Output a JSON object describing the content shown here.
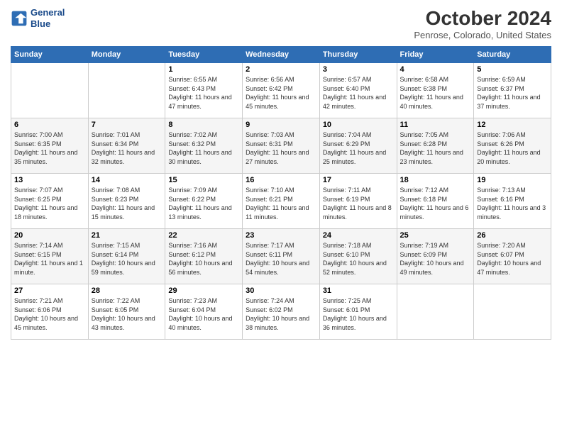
{
  "header": {
    "logo_line1": "General",
    "logo_line2": "Blue",
    "month_title": "October 2024",
    "subtitle": "Penrose, Colorado, United States"
  },
  "weekdays": [
    "Sunday",
    "Monday",
    "Tuesday",
    "Wednesday",
    "Thursday",
    "Friday",
    "Saturday"
  ],
  "weeks": [
    [
      {
        "day": "",
        "info": ""
      },
      {
        "day": "",
        "info": ""
      },
      {
        "day": "1",
        "info": "Sunrise: 6:55 AM\nSunset: 6:43 PM\nDaylight: 11 hours and 47 minutes."
      },
      {
        "day": "2",
        "info": "Sunrise: 6:56 AM\nSunset: 6:42 PM\nDaylight: 11 hours and 45 minutes."
      },
      {
        "day": "3",
        "info": "Sunrise: 6:57 AM\nSunset: 6:40 PM\nDaylight: 11 hours and 42 minutes."
      },
      {
        "day": "4",
        "info": "Sunrise: 6:58 AM\nSunset: 6:38 PM\nDaylight: 11 hours and 40 minutes."
      },
      {
        "day": "5",
        "info": "Sunrise: 6:59 AM\nSunset: 6:37 PM\nDaylight: 11 hours and 37 minutes."
      }
    ],
    [
      {
        "day": "6",
        "info": "Sunrise: 7:00 AM\nSunset: 6:35 PM\nDaylight: 11 hours and 35 minutes."
      },
      {
        "day": "7",
        "info": "Sunrise: 7:01 AM\nSunset: 6:34 PM\nDaylight: 11 hours and 32 minutes."
      },
      {
        "day": "8",
        "info": "Sunrise: 7:02 AM\nSunset: 6:32 PM\nDaylight: 11 hours and 30 minutes."
      },
      {
        "day": "9",
        "info": "Sunrise: 7:03 AM\nSunset: 6:31 PM\nDaylight: 11 hours and 27 minutes."
      },
      {
        "day": "10",
        "info": "Sunrise: 7:04 AM\nSunset: 6:29 PM\nDaylight: 11 hours and 25 minutes."
      },
      {
        "day": "11",
        "info": "Sunrise: 7:05 AM\nSunset: 6:28 PM\nDaylight: 11 hours and 23 minutes."
      },
      {
        "day": "12",
        "info": "Sunrise: 7:06 AM\nSunset: 6:26 PM\nDaylight: 11 hours and 20 minutes."
      }
    ],
    [
      {
        "day": "13",
        "info": "Sunrise: 7:07 AM\nSunset: 6:25 PM\nDaylight: 11 hours and 18 minutes."
      },
      {
        "day": "14",
        "info": "Sunrise: 7:08 AM\nSunset: 6:23 PM\nDaylight: 11 hours and 15 minutes."
      },
      {
        "day": "15",
        "info": "Sunrise: 7:09 AM\nSunset: 6:22 PM\nDaylight: 11 hours and 13 minutes."
      },
      {
        "day": "16",
        "info": "Sunrise: 7:10 AM\nSunset: 6:21 PM\nDaylight: 11 hours and 11 minutes."
      },
      {
        "day": "17",
        "info": "Sunrise: 7:11 AM\nSunset: 6:19 PM\nDaylight: 11 hours and 8 minutes."
      },
      {
        "day": "18",
        "info": "Sunrise: 7:12 AM\nSunset: 6:18 PM\nDaylight: 11 hours and 6 minutes."
      },
      {
        "day": "19",
        "info": "Sunrise: 7:13 AM\nSunset: 6:16 PM\nDaylight: 11 hours and 3 minutes."
      }
    ],
    [
      {
        "day": "20",
        "info": "Sunrise: 7:14 AM\nSunset: 6:15 PM\nDaylight: 11 hours and 1 minute."
      },
      {
        "day": "21",
        "info": "Sunrise: 7:15 AM\nSunset: 6:14 PM\nDaylight: 10 hours and 59 minutes."
      },
      {
        "day": "22",
        "info": "Sunrise: 7:16 AM\nSunset: 6:12 PM\nDaylight: 10 hours and 56 minutes."
      },
      {
        "day": "23",
        "info": "Sunrise: 7:17 AM\nSunset: 6:11 PM\nDaylight: 10 hours and 54 minutes."
      },
      {
        "day": "24",
        "info": "Sunrise: 7:18 AM\nSunset: 6:10 PM\nDaylight: 10 hours and 52 minutes."
      },
      {
        "day": "25",
        "info": "Sunrise: 7:19 AM\nSunset: 6:09 PM\nDaylight: 10 hours and 49 minutes."
      },
      {
        "day": "26",
        "info": "Sunrise: 7:20 AM\nSunset: 6:07 PM\nDaylight: 10 hours and 47 minutes."
      }
    ],
    [
      {
        "day": "27",
        "info": "Sunrise: 7:21 AM\nSunset: 6:06 PM\nDaylight: 10 hours and 45 minutes."
      },
      {
        "day": "28",
        "info": "Sunrise: 7:22 AM\nSunset: 6:05 PM\nDaylight: 10 hours and 43 minutes."
      },
      {
        "day": "29",
        "info": "Sunrise: 7:23 AM\nSunset: 6:04 PM\nDaylight: 10 hours and 40 minutes."
      },
      {
        "day": "30",
        "info": "Sunrise: 7:24 AM\nSunset: 6:02 PM\nDaylight: 10 hours and 38 minutes."
      },
      {
        "day": "31",
        "info": "Sunrise: 7:25 AM\nSunset: 6:01 PM\nDaylight: 10 hours and 36 minutes."
      },
      {
        "day": "",
        "info": ""
      },
      {
        "day": "",
        "info": ""
      }
    ]
  ]
}
